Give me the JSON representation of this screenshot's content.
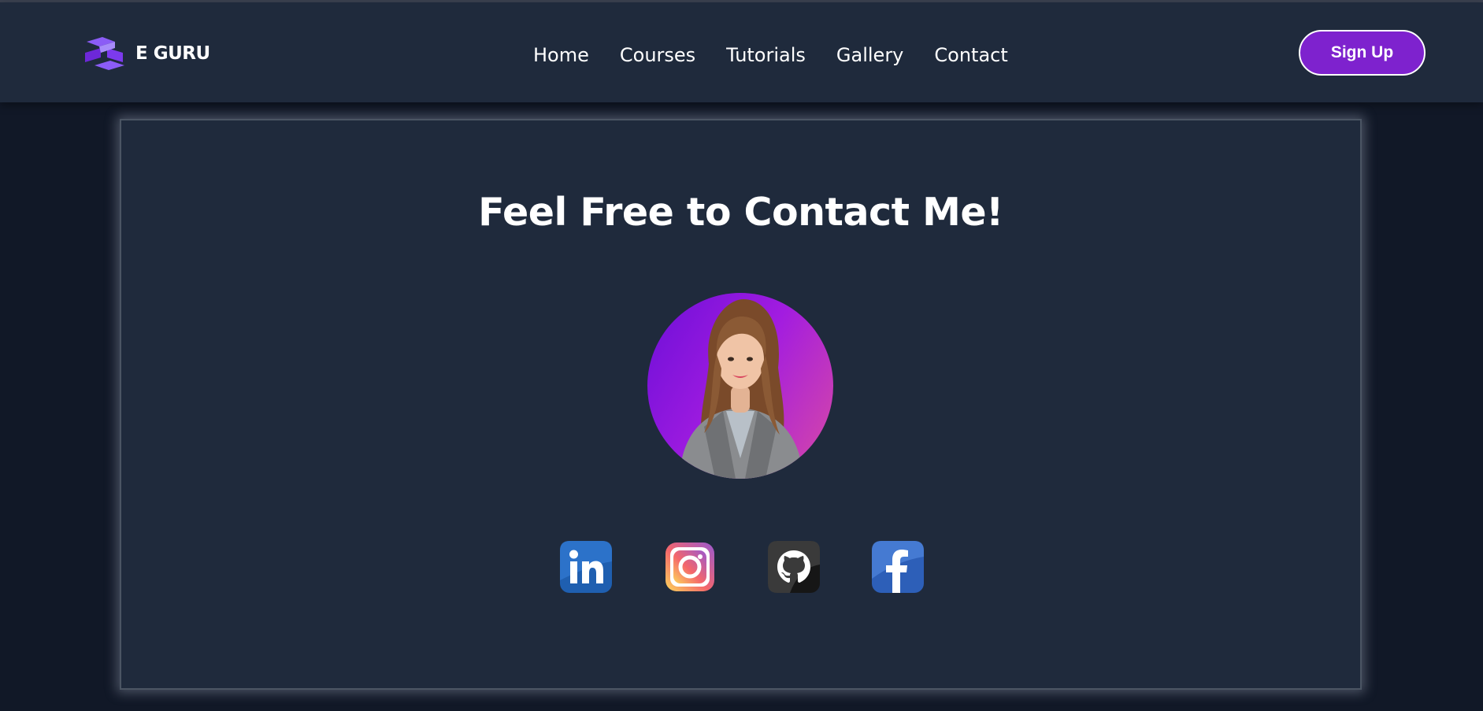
{
  "header": {
    "brand": "E GURU",
    "nav": [
      "Home",
      "Courses",
      "Tutorials",
      "Gallery",
      "Contact"
    ],
    "signup_label": "Sign Up",
    "logo_icon": "eguru-logo-icon"
  },
  "contact": {
    "heading": "Feel Free to Contact Me!",
    "avatar": "profile-photo",
    "socials": [
      "linkedin-icon",
      "instagram-icon",
      "github-icon",
      "facebook-icon"
    ]
  },
  "colors": {
    "page_bg": "#111827",
    "header_bg": "#1f2a3c",
    "card_bg": "#1f2a3c",
    "accent": "#7e22ce",
    "avatar_gradient": [
      "#6d0fd8",
      "#d94aa4"
    ]
  }
}
